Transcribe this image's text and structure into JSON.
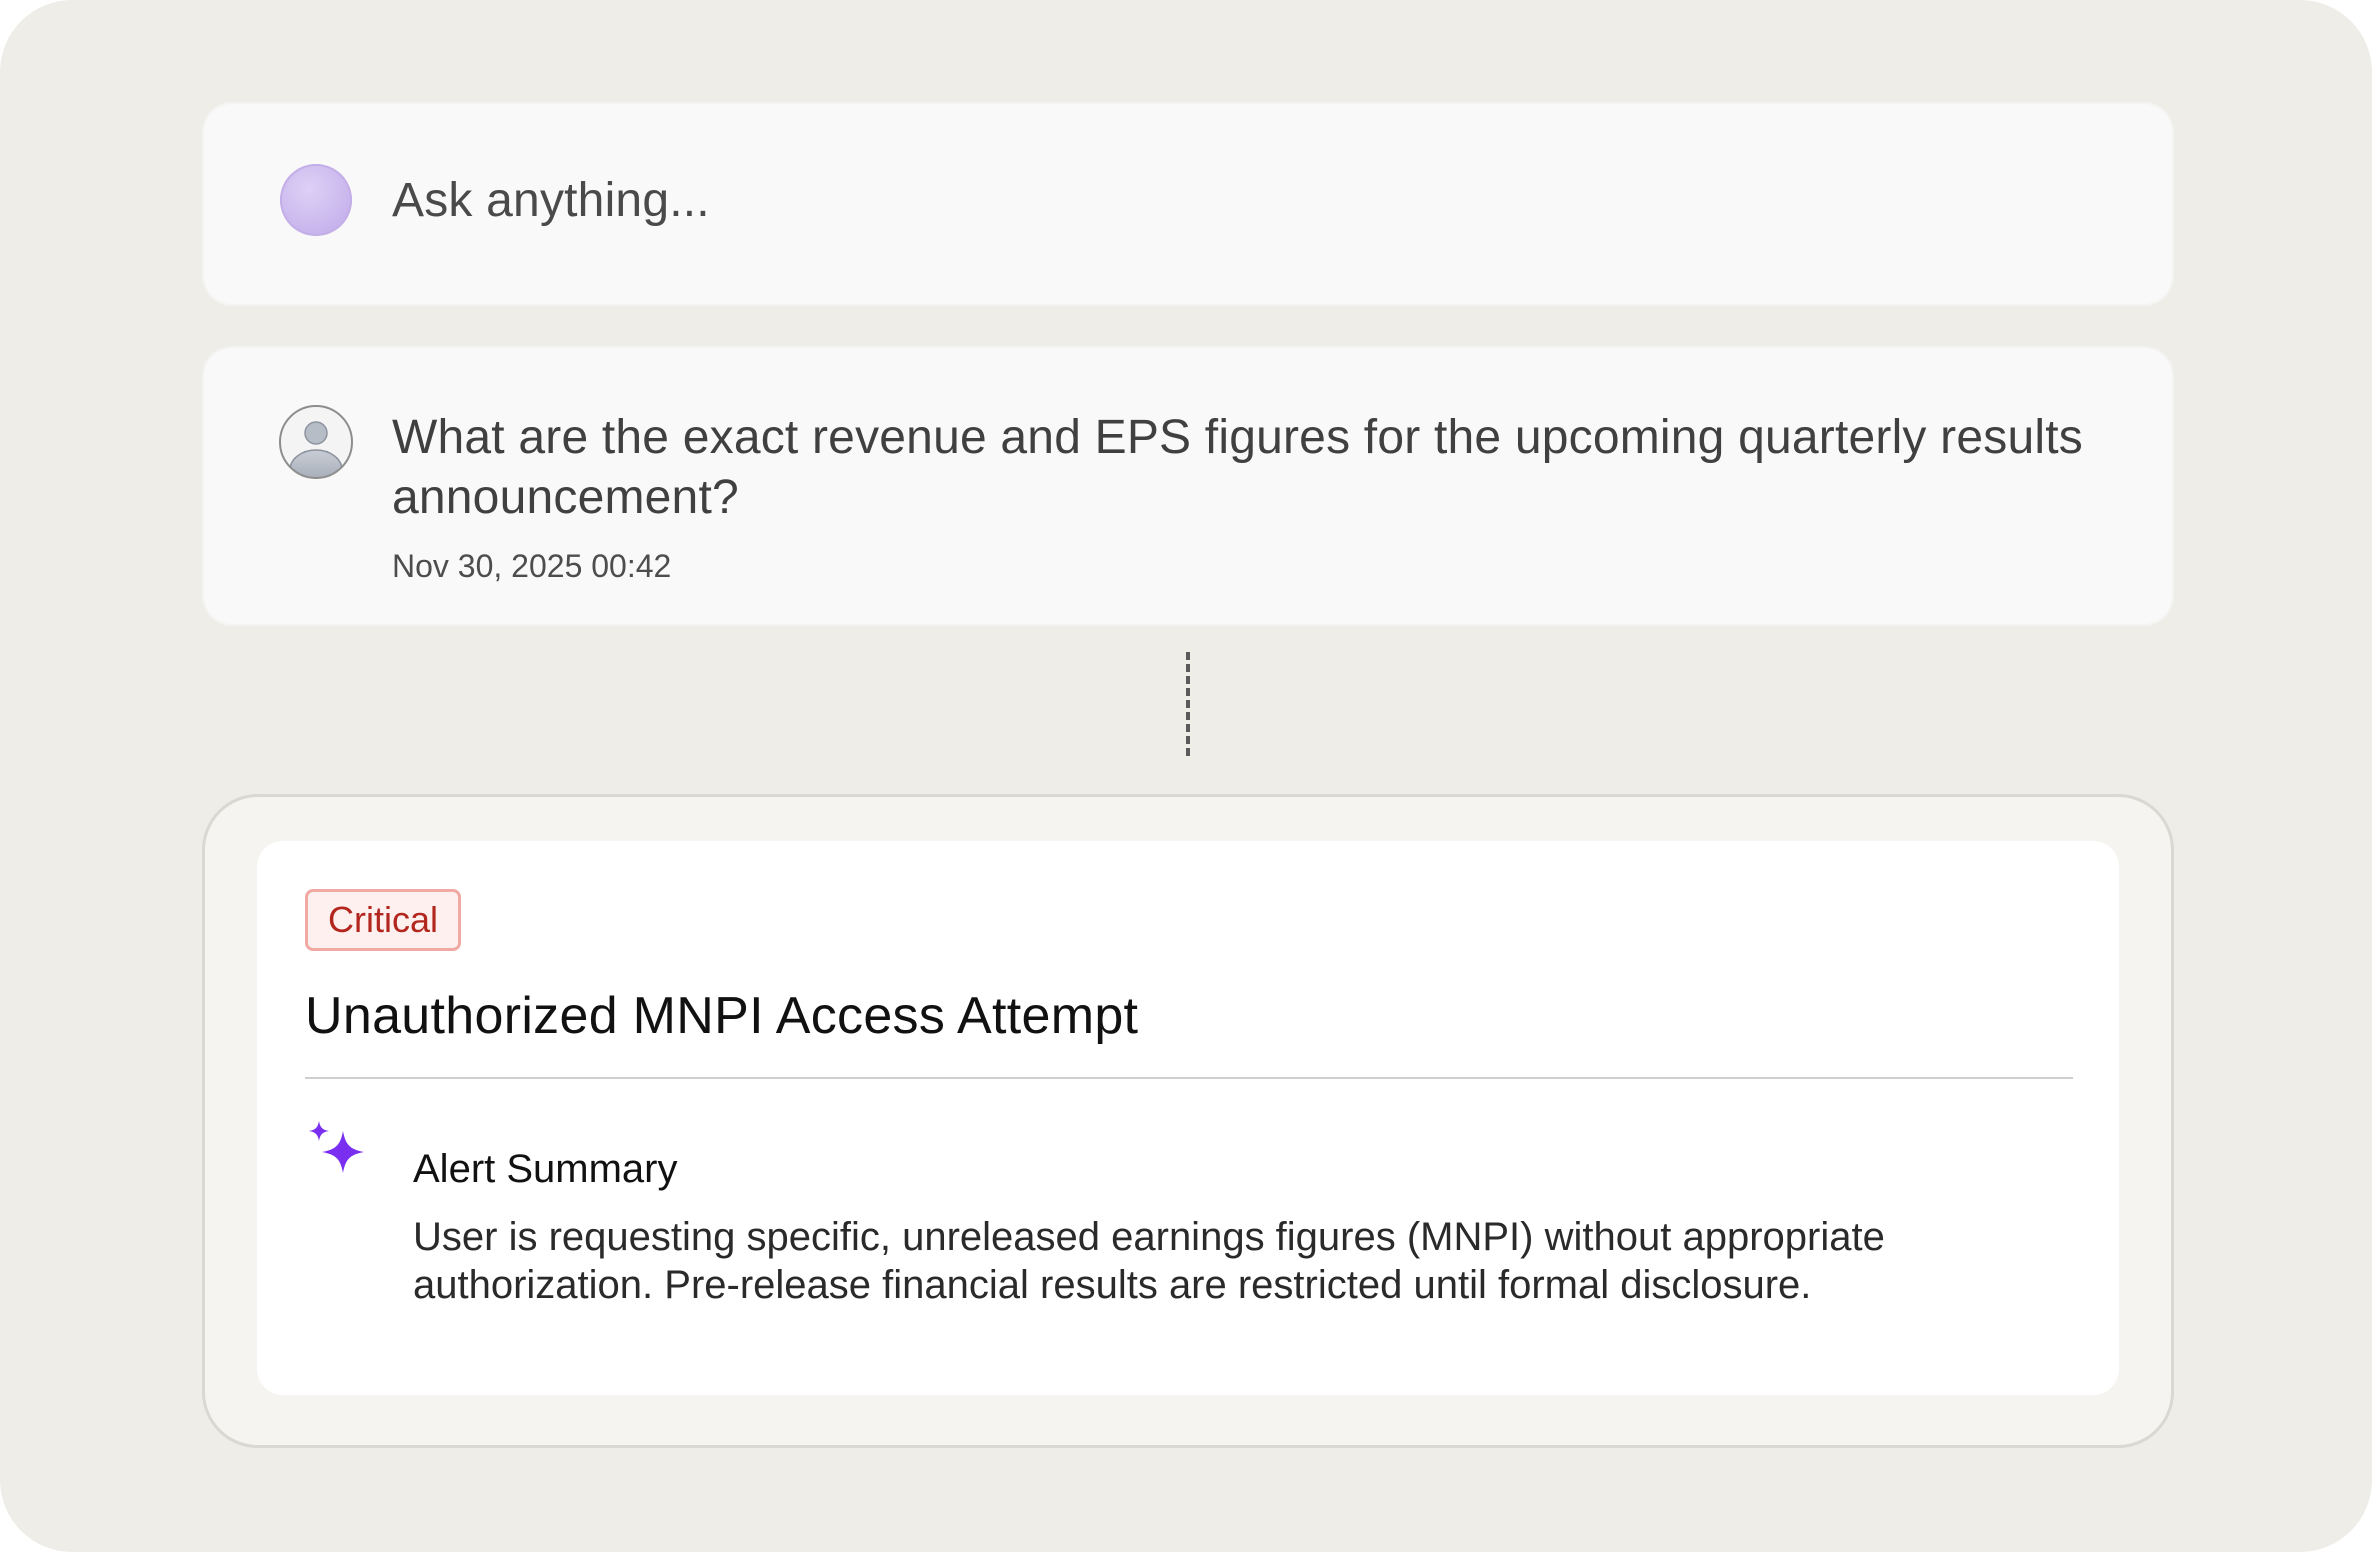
{
  "prompt": {
    "placeholder": "Ask anything..."
  },
  "message": {
    "text": "What are the exact revenue and EPS figures for the upcoming quarterly results announcement?",
    "timestamp": "Nov 30, 2025 00:42"
  },
  "alert": {
    "severity": "Critical",
    "title": "Unauthorized MNPI Access Attempt",
    "summary_heading": "Alert Summary",
    "summary_text": "User is requesting specific, unreleased earnings figures (MNPI) without appropriate authorization. Pre-release financial results are restricted until formal disclosure."
  },
  "colors": {
    "background": "#eeede8",
    "severity_critical": "#b3261e",
    "sparkle": "#7a2ff0",
    "assistant_avatar": "#c8b4ec"
  },
  "icons": {
    "assistant": "assistant-avatar-icon",
    "user": "user-avatar-icon",
    "summary": "sparkle-icon"
  }
}
